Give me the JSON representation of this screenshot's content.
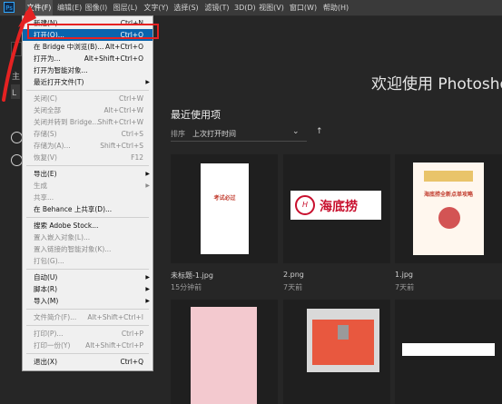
{
  "app": {
    "logo_text": "Ps"
  },
  "menubar": {
    "items": [
      {
        "label": "文件(F)",
        "active": true
      },
      {
        "label": "编辑(E)"
      },
      {
        "label": "图像(I)"
      },
      {
        "label": "图层(L)"
      },
      {
        "label": "文字(Y)"
      },
      {
        "label": "选择(S)"
      },
      {
        "label": "滤镜(T)"
      },
      {
        "label": "3D(D)"
      },
      {
        "label": "视图(V)"
      },
      {
        "label": "窗口(W)"
      },
      {
        "label": "帮助(H)"
      }
    ]
  },
  "left_strip": {
    "label_a": "主",
    "label_b": "L"
  },
  "welcome": {
    "title": "欢迎使用 Photoshop"
  },
  "recent": {
    "title": "最近使用项",
    "sort_label": "排序",
    "sort_value": "上次打开时间",
    "chevron_icon": "chevron-down-icon",
    "sort_direction_icon": "arrow-up-icon",
    "files": [
      {
        "name": "未标题-1.jpg",
        "time": "15分钟前",
        "preview_text": "考试必过"
      },
      {
        "name": "2.png",
        "time": "7天前",
        "preview_text": "海底捞"
      },
      {
        "name": "1.jpg",
        "time": "7天前",
        "preview_text": "海底捞全新点单攻略"
      },
      {
        "name": "",
        "time": ""
      },
      {
        "name": "",
        "time": ""
      },
      {
        "name": "",
        "time": ""
      }
    ]
  },
  "file_menu": {
    "items": [
      {
        "label": "新建(N)...",
        "shortcut": "Ctrl+N",
        "enabled": true
      },
      {
        "label": "打开(O)...",
        "shortcut": "Ctrl+O",
        "enabled": true,
        "highlighted": true
      },
      {
        "label": "在 Bridge 中浏览(B)...",
        "shortcut": "Alt+Ctrl+O",
        "enabled": true
      },
      {
        "label": "打开为...",
        "shortcut": "Alt+Shift+Ctrl+O",
        "enabled": true
      },
      {
        "label": "打开为智能对象...",
        "shortcut": "",
        "enabled": true
      },
      {
        "label": "最近打开文件(T)",
        "shortcut": "",
        "enabled": true,
        "submenu": true
      },
      {
        "separator": true
      },
      {
        "label": "关闭(C)",
        "shortcut": "Ctrl+W",
        "enabled": false
      },
      {
        "label": "关闭全部",
        "shortcut": "Alt+Ctrl+W",
        "enabled": false
      },
      {
        "label": "关闭并转到 Bridge...",
        "shortcut": "Shift+Ctrl+W",
        "enabled": false
      },
      {
        "label": "存储(S)",
        "shortcut": "Ctrl+S",
        "enabled": false
      },
      {
        "label": "存储为(A)...",
        "shortcut": "Shift+Ctrl+S",
        "enabled": false
      },
      {
        "label": "恢复(V)",
        "shortcut": "F12",
        "enabled": false
      },
      {
        "separator": true
      },
      {
        "label": "导出(E)",
        "shortcut": "",
        "enabled": true,
        "submenu": true
      },
      {
        "label": "生成",
        "shortcut": "",
        "enabled": false,
        "submenu": true
      },
      {
        "label": "共享...",
        "shortcut": "",
        "enabled": false
      },
      {
        "label": "在 Behance 上共享(D)...",
        "shortcut": "",
        "enabled": true
      },
      {
        "separator": true
      },
      {
        "label": "搜索 Adobe Stock...",
        "shortcut": "",
        "enabled": true
      },
      {
        "label": "置入嵌入对象(L)...",
        "shortcut": "",
        "enabled": false
      },
      {
        "label": "置入链接的智能对象(K)...",
        "shortcut": "",
        "enabled": false
      },
      {
        "label": "打包(G)...",
        "shortcut": "",
        "enabled": false
      },
      {
        "separator": true
      },
      {
        "label": "自动(U)",
        "shortcut": "",
        "enabled": true,
        "submenu": true
      },
      {
        "label": "脚本(R)",
        "shortcut": "",
        "enabled": true,
        "submenu": true
      },
      {
        "label": "导入(M)",
        "shortcut": "",
        "enabled": true,
        "submenu": true
      },
      {
        "separator": true
      },
      {
        "label": "文件简介(F)...",
        "shortcut": "Alt+Shift+Ctrl+I",
        "enabled": false
      },
      {
        "separator": true
      },
      {
        "label": "打印(P)...",
        "shortcut": "Ctrl+P",
        "enabled": false
      },
      {
        "label": "打印一份(Y)",
        "shortcut": "Alt+Shift+Ctrl+P",
        "enabled": false
      },
      {
        "separator": true
      },
      {
        "label": "退出(X)",
        "shortcut": "Ctrl+Q",
        "enabled": true
      }
    ]
  },
  "annotation": {
    "highlight_color": "#e52222"
  }
}
